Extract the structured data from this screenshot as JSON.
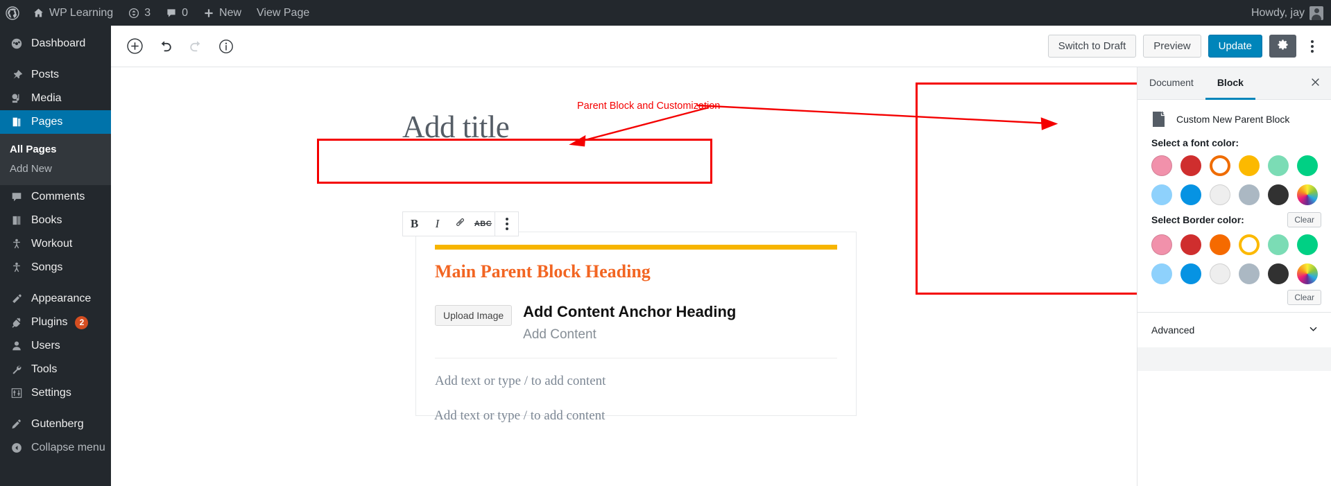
{
  "adminbar": {
    "logo_icon": "wordpress-icon",
    "site_icon": "home-icon",
    "site_name": "WP Learning",
    "updates_icon": "updates-icon",
    "updates_count": "3",
    "comments_icon": "comment-icon",
    "comments_count": "0",
    "new_icon": "plus-icon",
    "new_label": "New",
    "view_page_label": "View Page",
    "howdy": "Howdy, jay",
    "avatar_icon": "avatar-icon"
  },
  "sidebar": {
    "items": [
      {
        "label": "Dashboard",
        "icon": "dashboard-icon"
      },
      {
        "label": "Posts",
        "icon": "pin-icon"
      },
      {
        "label": "Media",
        "icon": "media-icon"
      },
      {
        "label": "Pages",
        "icon": "pages-icon"
      },
      {
        "label": "Comments",
        "icon": "comment-icon"
      },
      {
        "label": "Books",
        "icon": "book-icon"
      },
      {
        "label": "Workout",
        "icon": "person-icon"
      },
      {
        "label": "Songs",
        "icon": "person-icon"
      },
      {
        "label": "Appearance",
        "icon": "brush-icon"
      },
      {
        "label": "Plugins",
        "icon": "plug-icon",
        "badge": "2"
      },
      {
        "label": "Users",
        "icon": "user-icon"
      },
      {
        "label": "Tools",
        "icon": "wrench-icon"
      },
      {
        "label": "Settings",
        "icon": "sliders-icon"
      },
      {
        "label": "Gutenberg",
        "icon": "pencil-icon"
      },
      {
        "label": "Collapse menu",
        "icon": "collapse-icon"
      }
    ],
    "submenu": [
      {
        "label": "All Pages",
        "current": true
      },
      {
        "label": "Add New",
        "current": false
      }
    ]
  },
  "editor_header": {
    "add_block_icon": "plus-circle-icon",
    "undo_icon": "undo-icon",
    "redo_icon": "redo-icon",
    "info_icon": "info-icon",
    "switch_to_draft_label": "Switch to Draft",
    "preview_label": "Preview",
    "update_label": "Update",
    "settings_gear_icon": "gear-icon",
    "more_menu_icon": "kebab-icon"
  },
  "canvas": {
    "title_placeholder": "Add title",
    "block_toolbar": {
      "bold_label": "B",
      "italic_label": "I",
      "link_icon": "link-icon",
      "strikethrough_label": "ABC",
      "more_icon": "kebab-icon"
    },
    "parent_block": {
      "heading": "Main Parent Block Heading",
      "upload_button_label": "Upload Image",
      "anchor_heading": "Add Content Anchor Heading",
      "content_placeholder": "Add Content",
      "inner_paragraph_placeholder": "Add text or type / to add content"
    },
    "outer_paragraph_placeholder": "Add text or type / to add content"
  },
  "annotation": {
    "text": "Parent Block and Customization",
    "color": "#f40000"
  },
  "settings_panel": {
    "tabs": [
      {
        "label": "Document",
        "active": false
      },
      {
        "label": "Block",
        "active": true
      }
    ],
    "close_icon": "close-icon",
    "block_icon": "custom-block-icon",
    "block_name": "Custom New Parent Block",
    "font_color": {
      "label": "Select a font color:",
      "swatches": [
        {
          "name": "pink",
          "hex": "#f191ab"
        },
        {
          "name": "red",
          "hex": "#cf2e2e"
        },
        {
          "name": "orange",
          "hex": "#ef6c00",
          "selected": true
        },
        {
          "name": "amber",
          "hex": "#fcb900"
        },
        {
          "name": "light-green",
          "hex": "#7bdcb5"
        },
        {
          "name": "green",
          "hex": "#00d084"
        },
        {
          "name": "light-blue",
          "hex": "#8ed1fc"
        },
        {
          "name": "blue",
          "hex": "#0693e3"
        },
        {
          "name": "white",
          "hex": "#eeeeee"
        },
        {
          "name": "gray-blue",
          "hex": "#abb8c3"
        },
        {
          "name": "dark",
          "hex": "#313131"
        },
        {
          "name": "gradient",
          "hex": "gradient"
        }
      ]
    },
    "border_color": {
      "label": "Select Border color:",
      "clear_label": "Clear",
      "swatches": [
        {
          "name": "pink",
          "hex": "#f191ab"
        },
        {
          "name": "red",
          "hex": "#cf2e2e"
        },
        {
          "name": "orange",
          "hex": "#f56a00"
        },
        {
          "name": "yellow",
          "hex": "#fcb900",
          "selected": true
        },
        {
          "name": "light-green",
          "hex": "#7bdcb5"
        },
        {
          "name": "green",
          "hex": "#00d084"
        },
        {
          "name": "light-blue",
          "hex": "#8ed1fc"
        },
        {
          "name": "blue",
          "hex": "#0693e3"
        },
        {
          "name": "white",
          "hex": "#eeeeee"
        },
        {
          "name": "gray-blue",
          "hex": "#abb8c3"
        },
        {
          "name": "dark",
          "hex": "#313131"
        },
        {
          "name": "gradient",
          "hex": "gradient"
        }
      ],
      "clear_label_2": "Clear"
    },
    "advanced_label": "Advanced",
    "advanced_chevron_icon": "chevron-down-icon"
  }
}
